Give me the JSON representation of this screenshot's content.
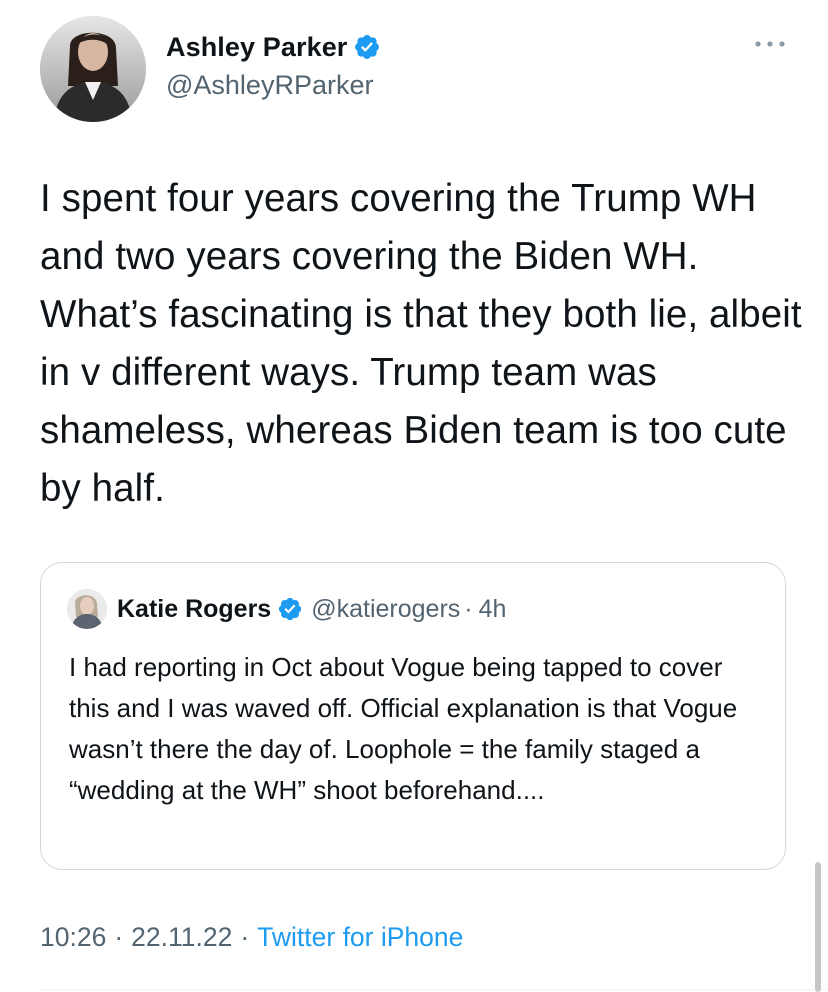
{
  "tweet": {
    "author": {
      "display_name": "Ashley Parker",
      "handle": "@AshleyRParker",
      "verified": true
    },
    "text": "I spent four years covering the Trump WH and two years covering the Biden WH. What’s fascinating is that they both lie, albeit in v different ways. Trump team was shameless, whereas Biden team is too cute by half.",
    "quoted_tweet": {
      "author": {
        "display_name": "Katie Rogers",
        "handle": "@katierogers",
        "verified": true
      },
      "separator": "·",
      "time": "4h",
      "text": "I had reporting in Oct about Vogue being tapped to cover this and I was waved off. Official explanation is that Vogue wasn’t there the day of. Loophole = the family staged a “wedding at the WH” shoot beforehand...."
    },
    "meta": {
      "time": "10:26",
      "separator": "·",
      "date": "22.11.22",
      "source": "Twitter for iPhone"
    }
  },
  "icons": {
    "more": "more-horizontal-icon",
    "verified": "verified-badge-icon"
  },
  "colors": {
    "text": "#0f1419",
    "secondary": "#536471",
    "accent": "#1d9bf0",
    "border": "#cfd9de"
  }
}
